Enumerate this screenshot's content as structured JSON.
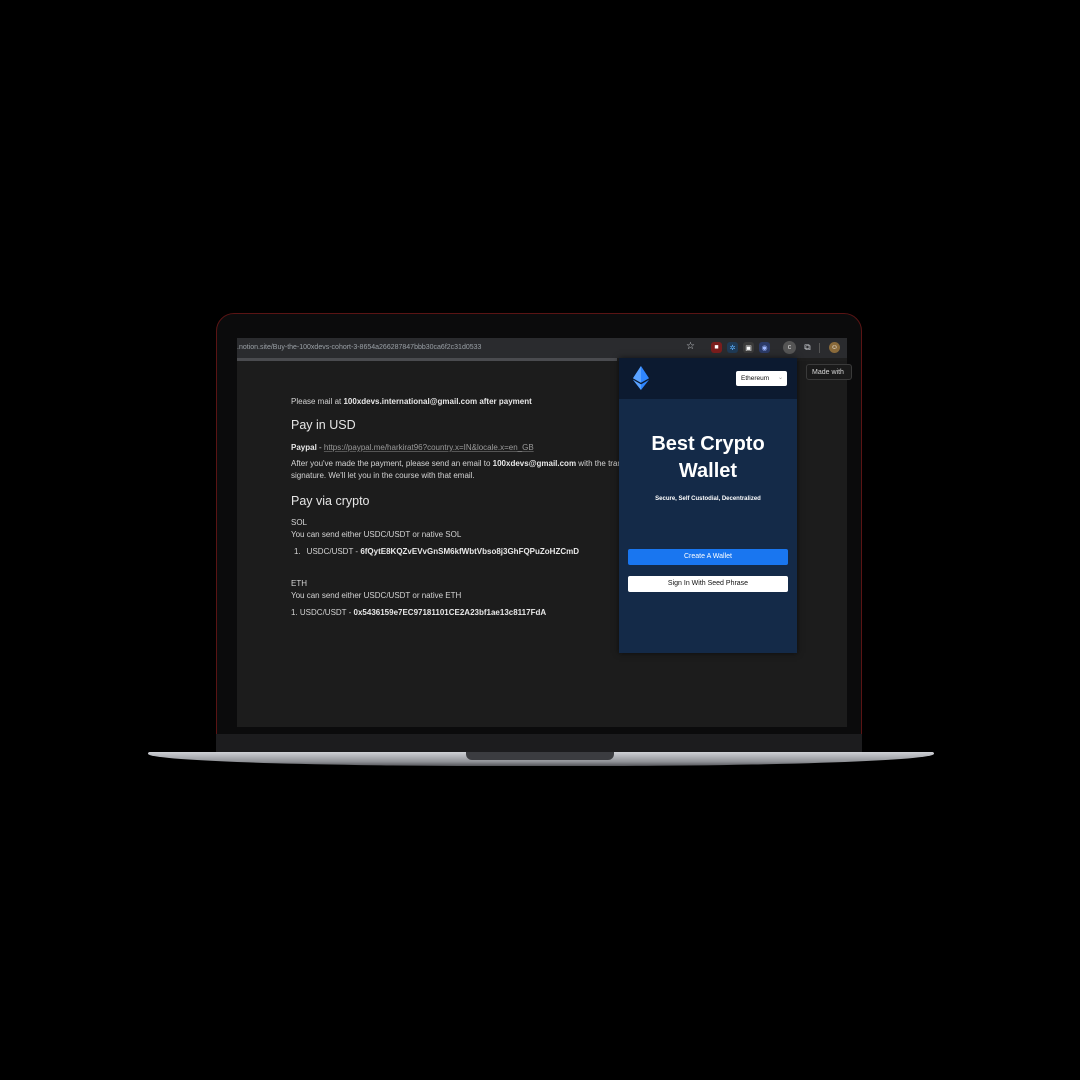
{
  "browser": {
    "url": ".notion.site/Buy-the-100xdevs-cohort-3-8654a266287847bbb30ca6f2c31d0533",
    "profile_initial": "c"
  },
  "page": {
    "mail_prefix": "Please mail at ",
    "mail_email": "100xdevs.international@gmail.com",
    "mail_suffix": " after payment",
    "usd_heading": "Pay in USD",
    "paypal_label": "Paypal",
    "paypal_sep": " - ",
    "paypal_link": "https://paypal.me/harkirat96?country.x=IN&locale.x=en_GB",
    "after_prefix": "After you've made the payment, please send an email to ",
    "after_email": "100xdevs@gmail.com",
    "after_suffix": " with the trans",
    "signature_line": "signature. We'll let you in the course with that email.",
    "crypto_heading": "Pay via crypto",
    "sol_label": "SOL",
    "sol_text": "You can send either USDC/USDT or native SOL",
    "sol_item_number": "1.",
    "sol_item_label": "USDC/USDT - ",
    "sol_address": "6fQytE8KQZvEVvGnSM6kfWbtVbso8j3GhFQPuZoHZCmD",
    "eth_label": "ETH",
    "eth_text": "You can send either USDC/USDT or native ETH",
    "eth_item_prefix": "1. USDC/USDT - ",
    "eth_address": "0x5436159e7EC97181101CE2A23bf1ae13c8117FdA",
    "made_with": "Made with"
  },
  "wallet": {
    "network": "Ethereum",
    "title_line1": "Best Crypto",
    "title_line2": "Wallet",
    "subtitle": "Secure, Self Custodial, Decentralized",
    "create_button": "Create A Wallet",
    "seed_button": "Sign In With Seed Phrase",
    "brand_color": "#1976f0",
    "panel_color": "#142a48"
  }
}
